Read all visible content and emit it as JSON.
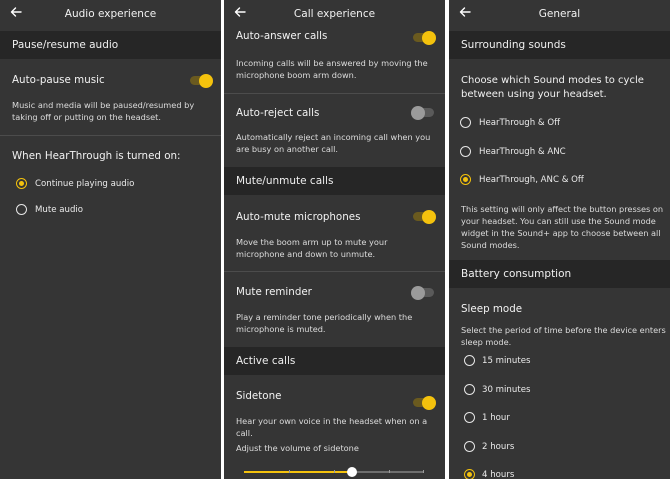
{
  "colors": {
    "accent": "#f4c20d",
    "background": "#353535",
    "section": "#262626"
  },
  "audio_experience": {
    "title": "Audio experience",
    "section_pause_resume": "Pause/resume audio",
    "auto_pause": {
      "label": "Auto-pause music",
      "enabled": true,
      "description": "Music and media will be paused/resumed by taking off or putting on the headset."
    },
    "hearthrough_heading": "When HearThrough is turned on:",
    "options": [
      {
        "label": "Continue playing audio",
        "selected": true
      },
      {
        "label": "Mute audio",
        "selected": false
      }
    ]
  },
  "call_experience": {
    "title": "Call experience",
    "auto_answer": {
      "label": "Auto-answer calls",
      "enabled": true,
      "description": "Incoming calls will be answered by moving the microphone boom arm down."
    },
    "auto_reject": {
      "label": "Auto-reject calls",
      "enabled": false,
      "description": "Automatically reject an incoming call when you are busy on another call."
    },
    "section_mute_unmute": "Mute/unmute calls",
    "auto_mute": {
      "label": "Auto-mute microphones",
      "enabled": true,
      "description": "Move the boom arm up to mute your microphone and down to unmute."
    },
    "mute_reminder": {
      "label": "Mute reminder",
      "enabled": false,
      "description": "Play a reminder tone periodically when the microphone is muted."
    },
    "section_active_calls": "Active calls",
    "sidetone": {
      "label": "Sidetone",
      "enabled": true,
      "description": "Hear your own voice in the headset when on a call.",
      "volume_label": "Adjust the volume of sidetone",
      "volume_fraction": 0.6
    }
  },
  "general": {
    "title": "General",
    "section_surrounding": "Surrounding sounds",
    "cycle_heading": "Choose which Sound modes to cycle between using your headset.",
    "sound_modes": [
      {
        "label": "HearThrough & Off",
        "selected": false
      },
      {
        "label": "HearThrough & ANC",
        "selected": false
      },
      {
        "label": "HearThrough, ANC & Off",
        "selected": true
      }
    ],
    "sound_modes_note": "This setting will only affect the button presses on your headset. You can still use the Sound mode widget in the Sound+ app to choose between all Sound modes.",
    "section_battery": "Battery consumption",
    "sleep_mode_label": "Sleep mode",
    "sleep_mode_description": "Select the period of time before the device enters sleep mode.",
    "sleep_options": [
      {
        "label": "15 minutes",
        "selected": false
      },
      {
        "label": "30 minutes",
        "selected": false
      },
      {
        "label": "1 hour",
        "selected": false
      },
      {
        "label": "2 hours",
        "selected": false
      },
      {
        "label": "4 hours",
        "selected": true
      }
    ]
  }
}
